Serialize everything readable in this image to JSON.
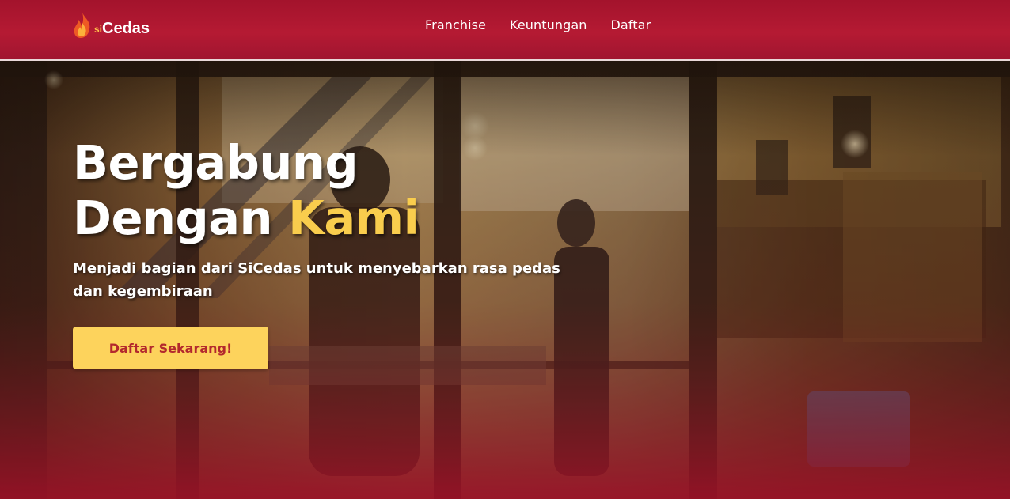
{
  "brand": {
    "prefix": "si",
    "name": "Cedas"
  },
  "nav": {
    "items": [
      {
        "label": "Franchise"
      },
      {
        "label": "Keuntungan"
      },
      {
        "label": "Daftar"
      }
    ]
  },
  "hero": {
    "title_line1": "Bergabung",
    "title_line2_main": "Dengan",
    "title_line2_accent": "Kami",
    "subtitle": "Menjadi bagian dari SiCedas untuk menyebarkan rasa pedas dan kegembiraan",
    "cta_label": "Daftar Sekarang!"
  },
  "colors": {
    "header_bg": "#a3132c",
    "accent": "#f9cd4d",
    "cta_bg": "#fdd35c",
    "cta_text": "#b3282d"
  },
  "icons": {
    "logo": "flame-icon"
  }
}
